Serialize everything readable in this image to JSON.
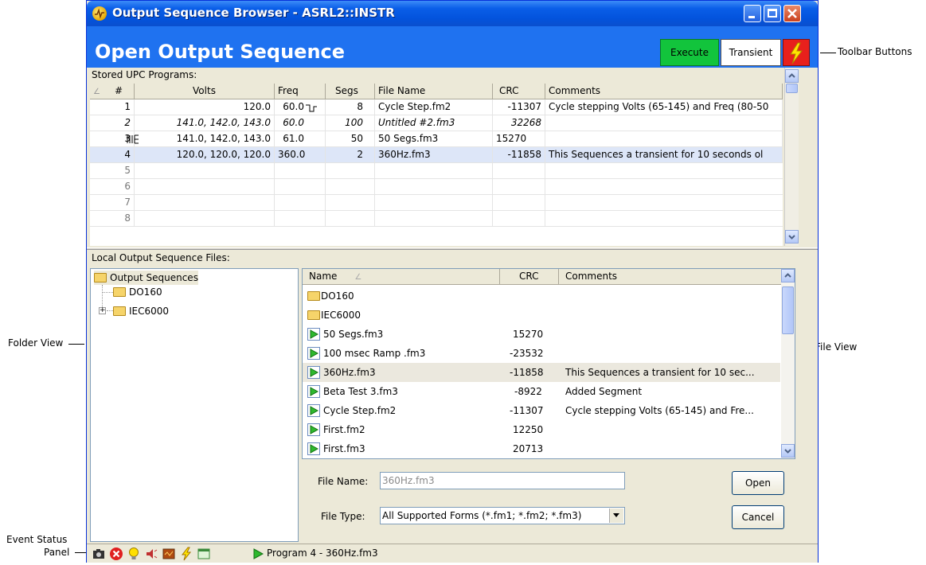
{
  "window": {
    "title": "Output Sequence Browser - ASRL2::INSTR",
    "header_title": "Open Output Sequence"
  },
  "toolbar": {
    "execute_label": "Execute",
    "transient_label": "Transient",
    "execute_color": "#12c43c",
    "bolt_color": "#e8201c"
  },
  "upc": {
    "section_label": "Stored UPC Programs:",
    "columns": [
      "#",
      "Volts",
      "Freq",
      "Segs",
      "File Name",
      "CRC",
      "Comments"
    ],
    "rows": [
      {
        "num": "1",
        "volts": "120.0",
        "freq": "60.0",
        "segs": "8",
        "file": "Cycle Step.fm2",
        "crc": "-11307",
        "comments": "Cycle stepping Volts (65-145) and Freq (80-50"
      },
      {
        "num": "2",
        "volts": "141.0, 142.0, 143.0",
        "freq": "60.0",
        "segs": "100",
        "file": "Untitled #2.fm3",
        "crc": "32268",
        "comments": ""
      },
      {
        "num": "3",
        "volts": "141.0, 142.0, 143.0",
        "freq": "61.0",
        "segs": "50",
        "file": "50 Segs.fm3",
        "crc": "15270",
        "comments": ""
      },
      {
        "num": "4",
        "volts": "120.0, 120.0, 120.0",
        "freq": "360.0",
        "segs": "2",
        "file": "360Hz.fm3",
        "crc": "-11858",
        "comments": "This Sequences a transient for 10 seconds ol"
      },
      {
        "num": "5"
      },
      {
        "num": "6"
      },
      {
        "num": "7"
      },
      {
        "num": "8"
      }
    ]
  },
  "local": {
    "section_label": "Local Output Sequence Files:",
    "tree": [
      "Output Sequences",
      "DO160",
      "IEC6000"
    ],
    "file_columns": [
      "Name",
      "CRC",
      "Comments"
    ],
    "files": [
      {
        "name": "DO160",
        "crc": "",
        "comments": "",
        "folder": true
      },
      {
        "name": "IEC6000",
        "crc": "",
        "comments": "",
        "folder": true
      },
      {
        "name": "50 Segs.fm3",
        "crc": "15270",
        "comments": ""
      },
      {
        "name": "100 msec Ramp .fm3",
        "crc": "-23532",
        "comments": ""
      },
      {
        "name": "360Hz.fm3",
        "crc": "-11858",
        "comments": "This Sequences a transient for 10 sec..."
      },
      {
        "name": "Beta Test 3.fm3",
        "crc": "-8922",
        "comments": "Added Segment"
      },
      {
        "name": "Cycle Step.fm2",
        "crc": "-11307",
        "comments": "Cycle stepping Volts (65-145) and Fre..."
      },
      {
        "name": "First.fm2",
        "crc": "12250",
        "comments": ""
      },
      {
        "name": "First.fm3",
        "crc": "20713",
        "comments": ""
      }
    ]
  },
  "form": {
    "file_name_label": "File Name:",
    "file_name_value": "360Hz.fm3",
    "file_type_label": "File Type:",
    "file_type_value": "All Supported Forms (*.fm1; *.fm2; *.fm3)",
    "open_label": "Open",
    "cancel_label": "Cancel"
  },
  "status": {
    "text": "Program 4 - 360Hz.fm3"
  },
  "annotations": {
    "toolbar_buttons": "Toolbar Buttons",
    "folder_view": "Folder View",
    "file_view": "File View",
    "event_status_line1": "Event Status",
    "event_status_line2": "Panel"
  }
}
